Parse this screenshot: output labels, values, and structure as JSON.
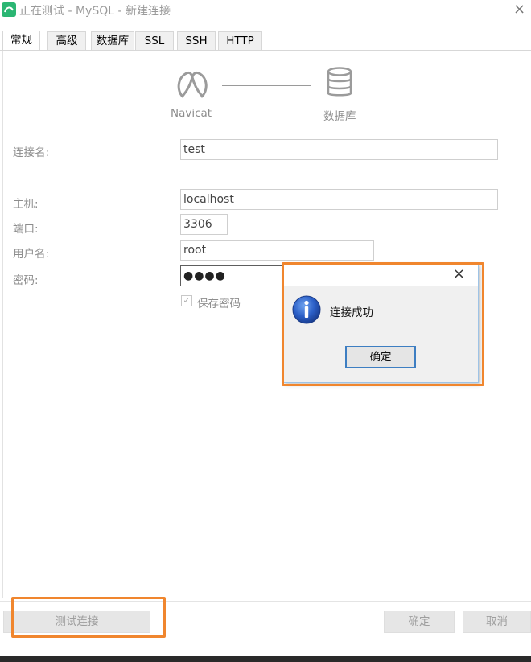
{
  "window": {
    "title": "正在测试 - MySQL - 新建连接",
    "close_glyph": "×"
  },
  "tabs": [
    {
      "label": "常规",
      "active": true
    },
    {
      "label": "高级"
    },
    {
      "label": "数据库"
    },
    {
      "label": "SSL"
    },
    {
      "label": "SSH"
    },
    {
      "label": "HTTP"
    }
  ],
  "diagram": {
    "left_caption": "Navicat",
    "right_caption": "数据库",
    "left_icon": "navicat-logo-icon",
    "right_icon": "database-icon"
  },
  "form": {
    "connection_name_label": "连接名:",
    "connection_name_value": "test",
    "host_label": "主机:",
    "host_value": "localhost",
    "port_label": "端口:",
    "port_value": "3306",
    "user_label": "用户名:",
    "user_value": "root",
    "password_label": "密码:",
    "password_value": "●●●●",
    "save_password_label": "保存密码",
    "save_password_checked": true
  },
  "buttons": {
    "test_connection": "测试连接",
    "ok": "确定",
    "cancel": "取消"
  },
  "dialog": {
    "message": "连接成功",
    "ok": "确定",
    "close_glyph": "×",
    "icon": "info-icon"
  },
  "colors": {
    "highlight": "#f0862e",
    "dialog_border": "#9ec3e6",
    "info_blue": "#1f55b8",
    "ok_focus": "#3d7ec2"
  }
}
